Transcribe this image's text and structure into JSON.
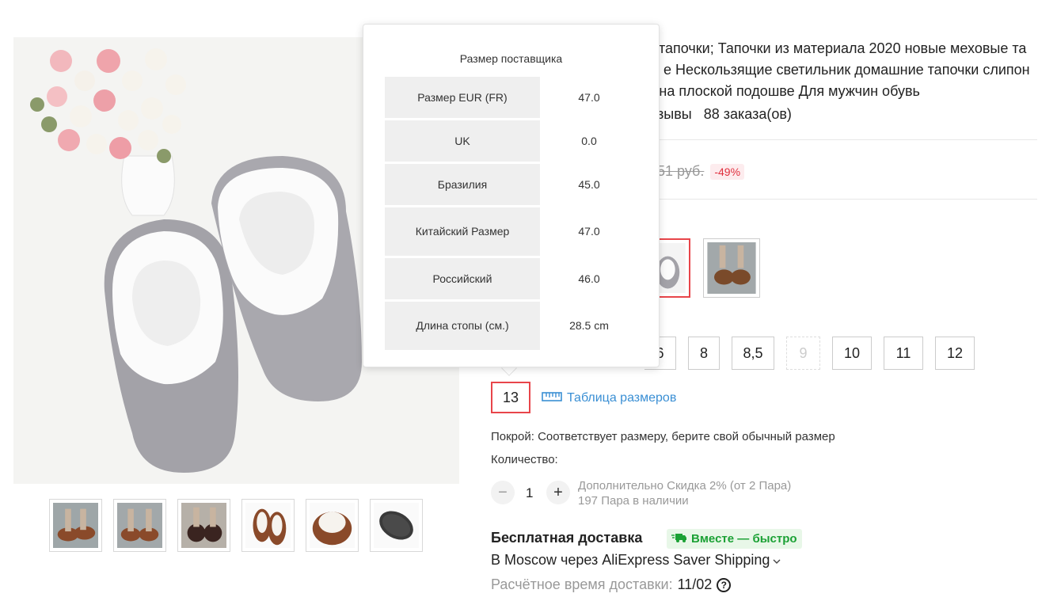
{
  "product": {
    "title_lines": [
      "тапочки; Тапочки из материала 2020 новые меховые та",
      "е Нескользящие светильник домашние тапочки слипон",
      "ь на плоской подошве Для мужчин обувь"
    ],
    "reviews_fragment": "зывы",
    "orders": "88 заказа(ов)"
  },
  "price": {
    "old_price": "51 руб.",
    "discount": "-49%"
  },
  "size_buttons": [
    {
      "label": "6"
    },
    {
      "label": "8"
    },
    {
      "label": "8,5"
    },
    {
      "label": "9",
      "disabled": true
    },
    {
      "label": "10"
    },
    {
      "label": "11"
    },
    {
      "label": "12"
    },
    {
      "label": "13",
      "selected": true
    }
  ],
  "size_table_link": "Таблица размеров",
  "fit": "Покрой: Соответствует размеру, берите свой обычный размер",
  "quantity": {
    "label": "Количество:",
    "minus": "−",
    "value": "1",
    "plus": "+",
    "discount_info": "Дополнительно Скидка 2% (от 2 Пара)",
    "stock": "197 Пара в наличии"
  },
  "shipping": {
    "title": "Бесплатная доставка",
    "badge": "Вместе — быстро",
    "via": "В Moscow через AliExpress Saver Shipping",
    "time_label": "Расчётное время доставки:",
    "time_value": "11/02",
    "help": "?"
  },
  "size_popover": {
    "title": "Размер поставщика",
    "rows": [
      {
        "label": "Размер EUR (FR)",
        "value": "47.0"
      },
      {
        "label": "UK",
        "value": "0.0"
      },
      {
        "label": "Бразилия",
        "value": "45.0"
      },
      {
        "label": "Китайский Размер",
        "value": "47.0"
      },
      {
        "label": "Российский",
        "value": "46.0"
      },
      {
        "label": "Длина стопы (см.)",
        "value": "28.5 cm"
      }
    ]
  },
  "colors": {
    "accent_red": "#e8454a",
    "link_blue": "#3a8fd4",
    "green": "#1ba135",
    "slipper_grey": "#a3a2a8",
    "slipper_brown": "#8a4a2a"
  }
}
